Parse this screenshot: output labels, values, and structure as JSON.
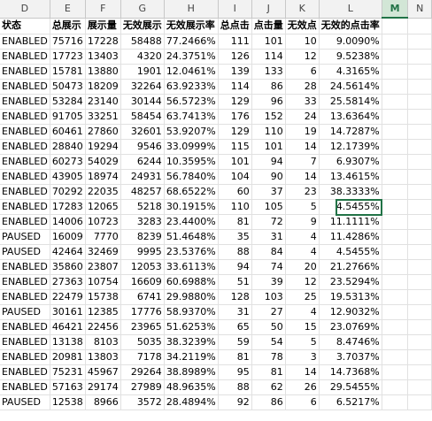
{
  "columns": [
    "D",
    "E",
    "F",
    "G",
    "H",
    "I",
    "J",
    "K",
    "L",
    "M",
    "N"
  ],
  "selected_column": "M",
  "headers": [
    "状态",
    "总展示",
    "展示量",
    "无效展示",
    "无效展示率",
    "总点击",
    "点击量",
    "无效点",
    "无效的点击率"
  ],
  "rows": [
    [
      "ENABLED",
      "75716",
      "17228",
      "58488",
      "77.2466%",
      "111",
      "101",
      "10",
      "9.0090%"
    ],
    [
      "ENABLED",
      "17723",
      "13403",
      "4320",
      "24.3751%",
      "126",
      "114",
      "12",
      "9.5238%"
    ],
    [
      "ENABLED",
      "15781",
      "13880",
      "1901",
      "12.0461%",
      "139",
      "133",
      "6",
      "4.3165%"
    ],
    [
      "ENABLED",
      "50473",
      "18209",
      "32264",
      "63.9233%",
      "114",
      "86",
      "28",
      "24.5614%"
    ],
    [
      "ENABLED",
      "53284",
      "23140",
      "30144",
      "56.5723%",
      "129",
      "96",
      "33",
      "25.5814%"
    ],
    [
      "ENABLED",
      "91705",
      "33251",
      "58454",
      "63.7413%",
      "176",
      "152",
      "24",
      "13.6364%"
    ],
    [
      "ENABLED",
      "60461",
      "27860",
      "32601",
      "53.9207%",
      "129",
      "110",
      "19",
      "14.7287%"
    ],
    [
      "ENABLED",
      "28840",
      "19294",
      "9546",
      "33.0999%",
      "115",
      "101",
      "14",
      "12.1739%"
    ],
    [
      "ENABLED",
      "60273",
      "54029",
      "6244",
      "10.3595%",
      "101",
      "94",
      "7",
      "6.9307%"
    ],
    [
      "ENABLED",
      "43905",
      "18974",
      "24931",
      "56.7840%",
      "104",
      "90",
      "14",
      "13.4615%"
    ],
    [
      "ENABLED",
      "70292",
      "22035",
      "48257",
      "68.6522%",
      "60",
      "37",
      "23",
      "38.3333%"
    ],
    [
      "ENABLED",
      "17283",
      "12065",
      "5218",
      "30.1915%",
      "110",
      "105",
      "5",
      "4.5455%"
    ],
    [
      "ENABLED",
      "14006",
      "10723",
      "3283",
      "23.4400%",
      "81",
      "72",
      "9",
      "11.1111%"
    ],
    [
      "PAUSED",
      "16009",
      "7770",
      "8239",
      "51.4648%",
      "35",
      "31",
      "4",
      "11.4286%"
    ],
    [
      "PAUSED",
      "42464",
      "32469",
      "9995",
      "23.5376%",
      "88",
      "84",
      "4",
      "4.5455%"
    ],
    [
      "ENABLED",
      "35860",
      "23807",
      "12053",
      "33.6113%",
      "94",
      "74",
      "20",
      "21.2766%"
    ],
    [
      "ENABLED",
      "27363",
      "10754",
      "16609",
      "60.6988%",
      "51",
      "39",
      "12",
      "23.5294%"
    ],
    [
      "ENABLED",
      "22479",
      "15738",
      "6741",
      "29.9880%",
      "128",
      "103",
      "25",
      "19.5313%"
    ],
    [
      "PAUSED",
      "30161",
      "12385",
      "17776",
      "58.9370%",
      "31",
      "27",
      "4",
      "12.9032%"
    ],
    [
      "ENABLED",
      "46421",
      "22456",
      "23965",
      "51.6253%",
      "65",
      "50",
      "15",
      "23.0769%"
    ],
    [
      "ENABLED",
      "13138",
      "8103",
      "5035",
      "38.3239%",
      "59",
      "54",
      "5",
      "8.4746%"
    ],
    [
      "ENABLED",
      "20981",
      "13803",
      "7178",
      "34.2119%",
      "81",
      "78",
      "3",
      "3.7037%"
    ],
    [
      "ENABLED",
      "75231",
      "45967",
      "29264",
      "38.8989%",
      "95",
      "81",
      "14",
      "14.7368%"
    ],
    [
      "ENABLED",
      "57163",
      "29174",
      "27989",
      "48.9635%",
      "88",
      "62",
      "26",
      "29.5455%"
    ],
    [
      "PAUSED",
      "12538",
      "8966",
      "3572",
      "28.4894%",
      "92",
      "86",
      "6",
      "6.5217%"
    ]
  ]
}
